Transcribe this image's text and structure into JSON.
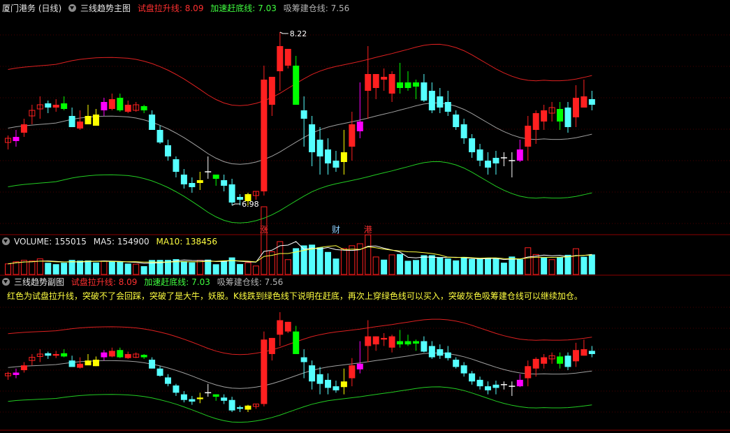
{
  "main_header": {
    "title": "厦门港务 (日线)",
    "indicator": "三线趋势主图",
    "line1_label": "试盘拉升线:",
    "line1_value": "8.09",
    "line2_label": "加速赶底线:",
    "line2_value": "7.03",
    "line3_label": "吸筹建仓线:",
    "line3_value": "7.56"
  },
  "volume_header": {
    "label": "VOLUME:",
    "value": "155015",
    "ma5_label": "MA5:",
    "ma5_value": "154900",
    "ma10_label": "MA10:",
    "ma10_value": "138456"
  },
  "sub_header": {
    "indicator": "三线趋势副图",
    "line1_label": "试盘拉升线:",
    "line1_value": "8.09",
    "line2_label": "加速赶底线:",
    "line2_value": "7.03",
    "line3_label": "吸筹建仓线:",
    "line3_value": "7.56"
  },
  "note": "红色为试盘拉升线，突破不了会回踩，突破了是大牛，妖股。K线跌到绿色线下说明在赶底，再次上穿绿色线可以买入，突破灰色吸筹建仓线可以继续加仓。",
  "colors": {
    "up": "#ff2020",
    "down": "#55ffff",
    "upper_band": "#dd2020",
    "mid_band": "#a0a0a0",
    "lower_band": "#22cc22",
    "ma5": "#ffffff",
    "ma10": "#ffff40",
    "signal_green": "#00ff00",
    "signal_yellow": "#ffff00",
    "signal_magenta": "#ff00ff"
  },
  "chart_data": [
    {
      "type": "candlestick",
      "title": "三线趋势主图",
      "ylim": [
        6.85,
        8.35
      ],
      "annotations": [
        {
          "text": "8.22",
          "kind": "high",
          "index": 34
        },
        {
          "text": "6.98",
          "kind": "low",
          "index": 28
        }
      ],
      "event_markers": [
        {
          "text": "涨",
          "index": 32,
          "color": "#ff3030"
        },
        {
          "text": "财",
          "index": 41,
          "color": "#8fd0ff"
        },
        {
          "text": "港",
          "index": 45,
          "color": "#ff3030"
        }
      ],
      "candles": [
        {
          "o": 7.43,
          "h": 7.48,
          "l": 7.38,
          "c": 7.46,
          "k": "up"
        },
        {
          "o": 7.44,
          "h": 7.52,
          "l": 7.4,
          "c": 7.47,
          "k": "mag"
        },
        {
          "o": 7.5,
          "h": 7.6,
          "l": 7.47,
          "c": 7.56,
          "k": "up"
        },
        {
          "o": 7.62,
          "h": 7.7,
          "l": 7.56,
          "c": 7.66,
          "k": "up"
        },
        {
          "o": 7.67,
          "h": 7.76,
          "l": 7.6,
          "c": 7.7,
          "k": "up"
        },
        {
          "o": 7.68,
          "h": 7.73,
          "l": 7.64,
          "c": 7.71,
          "k": "dn"
        },
        {
          "o": 7.7,
          "h": 7.74,
          "l": 7.65,
          "c": 7.68,
          "k": "up"
        },
        {
          "o": 7.71,
          "h": 7.76,
          "l": 7.66,
          "c": 7.67,
          "k": "grn"
        },
        {
          "o": 7.62,
          "h": 7.68,
          "l": 7.55,
          "c": 7.54,
          "k": "dn"
        },
        {
          "o": 7.58,
          "h": 7.66,
          "l": 7.52,
          "c": 7.53,
          "k": "up"
        },
        {
          "o": 7.62,
          "h": 7.7,
          "l": 7.57,
          "c": 7.56,
          "k": "yel"
        },
        {
          "o": 7.63,
          "h": 7.67,
          "l": 7.55,
          "c": 7.55,
          "k": "yel"
        },
        {
          "o": 7.66,
          "h": 7.75,
          "l": 7.62,
          "c": 7.72,
          "k": "mag"
        },
        {
          "o": 7.74,
          "h": 7.78,
          "l": 7.66,
          "c": 7.67,
          "k": "up"
        },
        {
          "o": 7.75,
          "h": 7.78,
          "l": 7.65,
          "c": 7.66,
          "k": "grn"
        },
        {
          "o": 7.7,
          "h": 7.73,
          "l": 7.64,
          "c": 7.65,
          "k": "up"
        },
        {
          "o": 7.66,
          "h": 7.72,
          "l": 7.65,
          "c": 7.7,
          "k": "up"
        },
        {
          "o": 7.69,
          "h": 7.7,
          "l": 7.64,
          "c": 7.66,
          "k": "grn"
        },
        {
          "o": 7.63,
          "h": 7.66,
          "l": 7.52,
          "c": 7.52,
          "k": "dn"
        },
        {
          "o": 7.52,
          "h": 7.55,
          "l": 7.42,
          "c": 7.43,
          "k": "dn"
        },
        {
          "o": 7.41,
          "h": 7.45,
          "l": 7.3,
          "c": 7.33,
          "k": "dn"
        },
        {
          "o": 7.31,
          "h": 7.33,
          "l": 7.18,
          "c": 7.22,
          "k": "dn"
        },
        {
          "o": 7.2,
          "h": 7.24,
          "l": 7.1,
          "c": 7.13,
          "k": "dn"
        },
        {
          "o": 7.14,
          "h": 7.18,
          "l": 7.07,
          "c": 7.11,
          "k": "dn"
        },
        {
          "o": 7.14,
          "h": 7.22,
          "l": 7.09,
          "c": 7.16,
          "k": "yel"
        },
        {
          "o": 7.21,
          "h": 7.33,
          "l": 7.17,
          "c": 7.22,
          "k": "doji"
        },
        {
          "o": 7.17,
          "h": 7.2,
          "l": 7.12,
          "c": 7.2,
          "k": "grn"
        },
        {
          "o": 7.16,
          "h": 7.2,
          "l": 7.08,
          "c": 7.12,
          "k": "dn"
        },
        {
          "o": 7.13,
          "h": 7.17,
          "l": 6.98,
          "c": 7.0,
          "k": "dn"
        },
        {
          "o": 7.04,
          "h": 7.06,
          "l": 6.98,
          "c": 7.02,
          "k": "dn"
        },
        {
          "o": 7.01,
          "h": 7.07,
          "l": 6.98,
          "c": 7.06,
          "k": "yel"
        },
        {
          "o": 7.05,
          "h": 7.08,
          "l": 7.02,
          "c": 7.08,
          "k": "up"
        },
        {
          "o": 7.08,
          "h": 7.98,
          "l": 7.05,
          "c": 7.88,
          "k": "up"
        },
        {
          "o": 7.7,
          "h": 7.9,
          "l": 7.62,
          "c": 7.9,
          "k": "up"
        },
        {
          "o": 7.94,
          "h": 8.22,
          "l": 7.8,
          "c": 8.12,
          "k": "up"
        },
        {
          "o": 7.98,
          "h": 8.1,
          "l": 7.96,
          "c": 8.1,
          "k": "up"
        },
        {
          "o": 7.98,
          "h": 8.05,
          "l": 7.72,
          "c": 7.7,
          "k": "grn"
        },
        {
          "o": 7.66,
          "h": 7.76,
          "l": 7.4,
          "c": 7.6,
          "k": "dn"
        },
        {
          "o": 7.56,
          "h": 7.62,
          "l": 7.26,
          "c": 7.36,
          "k": "dn"
        },
        {
          "o": 7.45,
          "h": 7.54,
          "l": 7.2,
          "c": 7.33,
          "k": "dn"
        },
        {
          "o": 7.38,
          "h": 7.46,
          "l": 7.2,
          "c": 7.28,
          "k": "dn"
        },
        {
          "o": 7.3,
          "h": 7.37,
          "l": 7.22,
          "c": 7.25,
          "k": "dn"
        },
        {
          "o": 7.29,
          "h": 7.52,
          "l": 7.2,
          "c": 7.36,
          "k": "yel"
        },
        {
          "o": 7.4,
          "h": 7.65,
          "l": 7.3,
          "c": 7.56,
          "k": "up"
        },
        {
          "o": 7.51,
          "h": 7.86,
          "l": 7.46,
          "c": 7.58,
          "k": "mag"
        },
        {
          "o": 7.8,
          "h": 8.12,
          "l": 7.6,
          "c": 7.92,
          "k": "up"
        },
        {
          "o": 7.82,
          "h": 7.92,
          "l": 7.74,
          "c": 7.92,
          "k": "up"
        },
        {
          "o": 7.9,
          "h": 7.96,
          "l": 7.8,
          "c": 7.88,
          "k": "up"
        },
        {
          "o": 7.78,
          "h": 7.94,
          "l": 7.72,
          "c": 7.92,
          "k": "up"
        },
        {
          "o": 7.82,
          "h": 8.0,
          "l": 7.78,
          "c": 7.86,
          "k": "grn"
        },
        {
          "o": 7.86,
          "h": 7.94,
          "l": 7.8,
          "c": 7.82,
          "k": "grn"
        },
        {
          "o": 7.83,
          "h": 7.88,
          "l": 7.74,
          "c": 7.86,
          "k": "grn"
        },
        {
          "o": 7.86,
          "h": 7.92,
          "l": 7.72,
          "c": 7.73,
          "k": "dn"
        },
        {
          "o": 7.8,
          "h": 7.86,
          "l": 7.64,
          "c": 7.66,
          "k": "dn"
        },
        {
          "o": 7.76,
          "h": 7.82,
          "l": 7.64,
          "c": 7.68,
          "k": "dn"
        },
        {
          "o": 7.72,
          "h": 7.8,
          "l": 7.62,
          "c": 7.65,
          "k": "dn"
        },
        {
          "o": 7.63,
          "h": 7.66,
          "l": 7.52,
          "c": 7.54,
          "k": "dn"
        },
        {
          "o": 7.56,
          "h": 7.6,
          "l": 7.42,
          "c": 7.46,
          "k": "dn"
        },
        {
          "o": 7.46,
          "h": 7.49,
          "l": 7.32,
          "c": 7.36,
          "k": "dn"
        },
        {
          "o": 7.38,
          "h": 7.42,
          "l": 7.26,
          "c": 7.3,
          "k": "dn"
        },
        {
          "o": 7.3,
          "h": 7.36,
          "l": 7.2,
          "c": 7.25,
          "k": "dn"
        },
        {
          "o": 7.28,
          "h": 7.37,
          "l": 7.2,
          "c": 7.32,
          "k": "dn"
        },
        {
          "o": 7.32,
          "h": 7.36,
          "l": 7.26,
          "c": 7.31,
          "k": "doji"
        },
        {
          "o": 7.3,
          "h": 7.36,
          "l": 7.18,
          "c": 7.3,
          "k": "doji"
        },
        {
          "o": 7.38,
          "h": 7.45,
          "l": 7.29,
          "c": 7.3,
          "k": "mag"
        },
        {
          "o": 7.4,
          "h": 7.62,
          "l": 7.3,
          "c": 7.55,
          "k": "up"
        },
        {
          "o": 7.52,
          "h": 7.66,
          "l": 7.42,
          "c": 7.64,
          "k": "up"
        },
        {
          "o": 7.66,
          "h": 7.7,
          "l": 7.52,
          "c": 7.58,
          "k": "up"
        },
        {
          "o": 7.64,
          "h": 7.72,
          "l": 7.58,
          "c": 7.68,
          "k": "up"
        },
        {
          "o": 7.67,
          "h": 7.72,
          "l": 7.52,
          "c": 7.58,
          "k": "grn"
        },
        {
          "o": 7.68,
          "h": 7.72,
          "l": 7.5,
          "c": 7.54,
          "k": "dn"
        },
        {
          "o": 7.61,
          "h": 7.84,
          "l": 7.54,
          "c": 7.75,
          "k": "up"
        },
        {
          "o": 7.76,
          "h": 7.88,
          "l": 7.68,
          "c": 7.68,
          "k": "up"
        },
        {
          "o": 7.74,
          "h": 7.8,
          "l": 7.66,
          "c": 7.7,
          "k": "dn"
        }
      ]
    },
    {
      "type": "bar",
      "title": "VOLUME",
      "ylim": [
        0,
        200000
      ],
      "ma5_last": 154900,
      "ma10_last": 138456,
      "last_value": 155015
    },
    {
      "type": "candlestick",
      "title": "三线趋势副图"
    }
  ]
}
